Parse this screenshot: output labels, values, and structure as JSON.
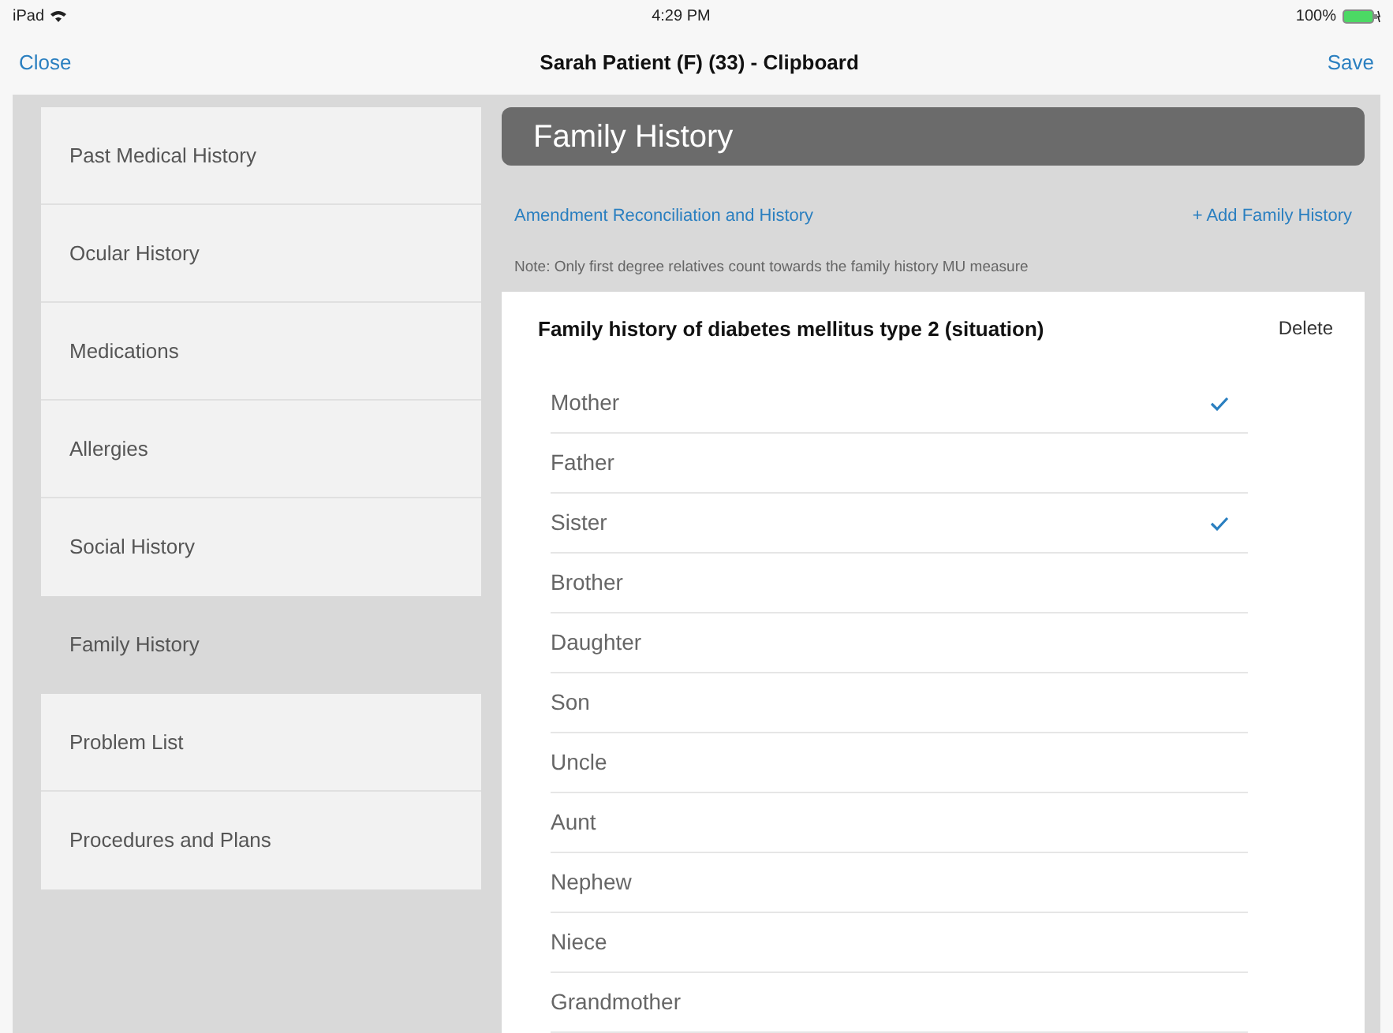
{
  "status_bar": {
    "device": "iPad",
    "time": "4:29 PM",
    "battery": "100%"
  },
  "nav": {
    "left": "Close",
    "title": "Sarah Patient (F) (33)  - Clipboard",
    "right": "Save"
  },
  "sidebar": {
    "items": [
      {
        "label": "Past Medical History",
        "selected": false
      },
      {
        "label": "Ocular History",
        "selected": false
      },
      {
        "label": "Medications",
        "selected": false
      },
      {
        "label": "Allergies",
        "selected": false
      },
      {
        "label": "Social History",
        "selected": false
      },
      {
        "label": "Family History",
        "selected": true
      },
      {
        "label": "Problem List",
        "selected": false
      },
      {
        "label": "Procedures and Plans",
        "selected": false
      }
    ]
  },
  "main": {
    "header": "Family History",
    "link_left": "Amendment Reconciliation and History",
    "link_right": "+ Add Family History",
    "note": "Note: Only first degree relatives count towards the family history MU measure",
    "card": {
      "title": "Family history of diabetes mellitus type 2 (situation)",
      "delete": "Delete",
      "relatives": [
        {
          "label": "Mother",
          "checked": true
        },
        {
          "label": "Father",
          "checked": false
        },
        {
          "label": "Sister",
          "checked": true
        },
        {
          "label": "Brother",
          "checked": false
        },
        {
          "label": "Daughter",
          "checked": false
        },
        {
          "label": "Son",
          "checked": false
        },
        {
          "label": "Uncle",
          "checked": false
        },
        {
          "label": "Aunt",
          "checked": false
        },
        {
          "label": "Nephew",
          "checked": false
        },
        {
          "label": "Niece",
          "checked": false
        },
        {
          "label": "Grandmother",
          "checked": false
        }
      ]
    }
  }
}
